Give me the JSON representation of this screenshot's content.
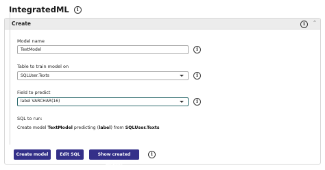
{
  "app": {
    "title": "IntegratedML"
  },
  "panel": {
    "title": "Create"
  },
  "form": {
    "model_name_label": "Model name",
    "model_name_value": "TextModel",
    "table_label": "Table to train model on",
    "table_value": "SQLUser.Texts",
    "field_label": "Field to predict",
    "field_value": "label VARCHAR(16)"
  },
  "sql": {
    "label": "SQL to run:",
    "prefix": "Create model ",
    "model": "TextModel",
    "middle1": " predicting (",
    "field": "label",
    "middle2": ") from ",
    "table": "SQLUser.Texts"
  },
  "buttons": {
    "create_model": "Create model",
    "edit_sql": "Edit SQL",
    "show_models": "Show created models"
  },
  "icons": {
    "info_glyph": "i",
    "collapse_glyph": "⌃"
  },
  "colors": {
    "button_bg": "#343089",
    "focus_border": "#2d6b6e",
    "header_bg": "#ececec"
  }
}
